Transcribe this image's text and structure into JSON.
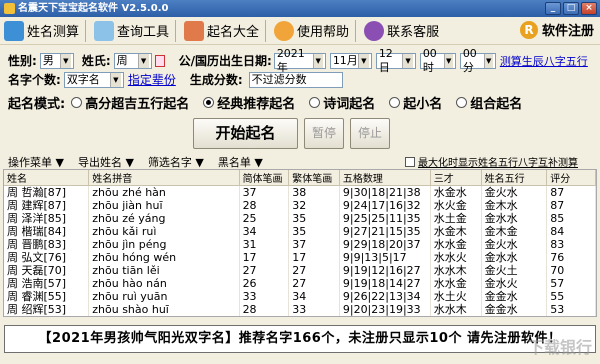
{
  "window": {
    "title": "名震天下宝宝起名软件 V2.5.0.0"
  },
  "toolbar": [
    {
      "label": "姓名测算",
      "icon": "calculator-icon",
      "color": "#3d8fd6"
    },
    {
      "label": "查询工具",
      "icon": "search-icon",
      "color": "#8cc2e8"
    },
    {
      "label": "起名大全",
      "icon": "book-icon",
      "color": "#e07a4a"
    },
    {
      "label": "使用帮助",
      "icon": "help-icon",
      "color": "#f0a43a"
    },
    {
      "label": "联系客服",
      "icon": "customer-service-icon",
      "color": "#8b4fb3"
    }
  ],
  "register": {
    "label": "软件注册",
    "icon_letter": "R"
  },
  "form": {
    "gender_label": "性别:",
    "gender_value": "男",
    "surname_label": "姓氏:",
    "surname_value": "周",
    "birth_label": "公/国历出生日期:",
    "year": "2021年",
    "month": "11月",
    "day": "12日",
    "hour": "00时",
    "minute": "00分",
    "bazi_link": "测算生辰八字五行",
    "name_len_label": "名字个数:",
    "name_len_value": "双字名",
    "zibei_link": "指定辈份",
    "score_label": "生成分数:",
    "score_value": "不过滤分数"
  },
  "mode": {
    "label": "起名模式:",
    "options": [
      "高分超吉五行起名",
      "经典推荐起名",
      "诗词起名",
      "起小名",
      "组合起名"
    ],
    "selected": 1
  },
  "buttons": {
    "start": "开始起名",
    "pause": "暂停",
    "stop": "停止"
  },
  "menubar": {
    "op": "操作菜单 ▼",
    "export": "导出姓名 ▼",
    "filter": "筛选名字 ▼",
    "blacklist": "黑名单 ▼",
    "checkbox": "最大化时显示姓名五行八字互补测算"
  },
  "table": {
    "columns": [
      "姓名",
      "姓名拼音",
      "简体笔画",
      "繁体笔画",
      "五格数理",
      "三才",
      "姓名五行",
      "评分"
    ],
    "rows": [
      [
        "周 哲瀚[87]",
        "zhōu zhé hàn",
        "37",
        "38",
        "9|30|18|21|38",
        "水金水",
        "金火水",
        "87"
      ],
      [
        "周 建辉[87]",
        "zhōu jiàn huī",
        "28",
        "32",
        "9|24|17|16|32",
        "水火金",
        "金木水",
        "87"
      ],
      [
        "周 泽洋[85]",
        "zhōu zé yáng",
        "25",
        "35",
        "9|25|25|11|35",
        "水土金",
        "金水水",
        "85"
      ],
      [
        "周 楷瑞[84]",
        "zhōu kǎi ruì",
        "34",
        "35",
        "9|27|21|15|35",
        "水金木",
        "金木金",
        "84"
      ],
      [
        "周 晋鹏[83]",
        "zhōu jìn péng",
        "31",
        "37",
        "9|29|18|20|37",
        "水水金",
        "金火水",
        "83"
      ],
      [
        "周 弘文[76]",
        "zhōu hóng wén",
        "17",
        "17",
        "9|9|13|5|17",
        "水水火",
        "金水水",
        "76"
      ],
      [
        "周 天磊[70]",
        "zhōu tiān lěi",
        "27",
        "27",
        "9|19|12|16|27",
        "水水木",
        "金火土",
        "70"
      ],
      [
        "周 浩南[57]",
        "zhōu hào nán",
        "26",
        "27",
        "9|19|18|14|27",
        "水水金",
        "金水火",
        "57"
      ],
      [
        "周 睿渊[55]",
        "zhōu ruì yuān",
        "33",
        "34",
        "9|26|22|13|34",
        "水土火",
        "金金水",
        "55"
      ],
      [
        "周 绍辉[53]",
        "zhōu shào huī",
        "28",
        "33",
        "9|20|23|19|33",
        "水水木",
        "金金水",
        "53"
      ]
    ]
  },
  "banner": "【2021年男孩帅气阳光双字名】推荐名字166个，未注册只显示10个 请先注册软件！",
  "watermark": "下载银行"
}
